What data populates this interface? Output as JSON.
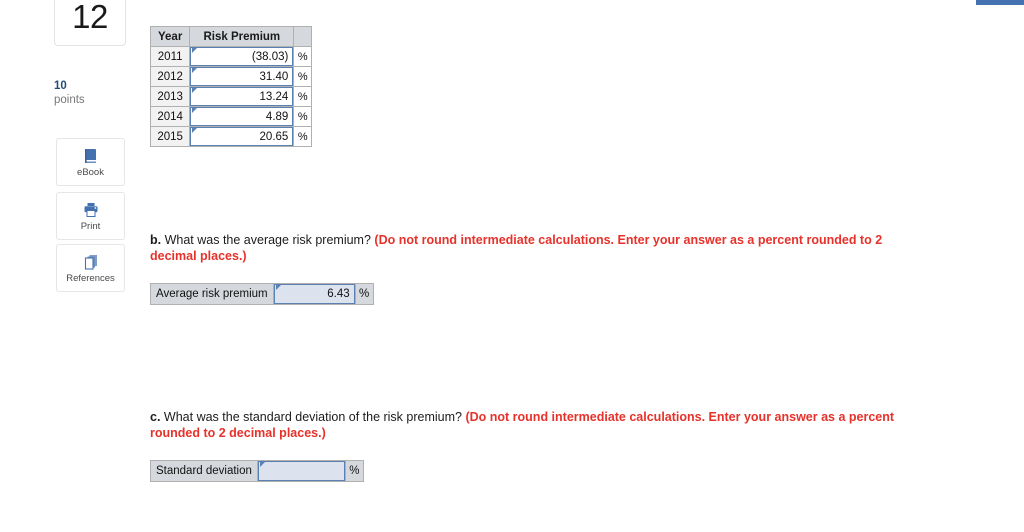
{
  "window": {
    "accent_color": "#4472b0",
    "top_bar_name": "cut-off-toolbar-strip"
  },
  "sidebar": {
    "question_number": "12",
    "points_value": "10",
    "points_label": "points",
    "tools": [
      {
        "label": "eBook",
        "icon": "ebook-icon"
      },
      {
        "label": "Print",
        "icon": "printer-icon"
      },
      {
        "label": "References",
        "icon": "references-icon"
      }
    ]
  },
  "risk_premium_table": {
    "headers": [
      "Year",
      "Risk Premium",
      ""
    ],
    "rows": [
      {
        "year": "2011",
        "value": "(38.03)",
        "unit": "%"
      },
      {
        "year": "2012",
        "value": "31.40",
        "unit": "%"
      },
      {
        "year": "2013",
        "value": "13.24",
        "unit": "%"
      },
      {
        "year": "2014",
        "value": "4.89",
        "unit": "%"
      },
      {
        "year": "2015",
        "value": "20.65",
        "unit": "%"
      }
    ]
  },
  "question_b": {
    "label": "b.",
    "prompt": "What was the average risk premium?",
    "instruction": "(Do not round intermediate calculations. Enter your answer as a percent rounded to 2 decimal places.)",
    "answer_label": "Average risk premium",
    "answer_value": "6.43",
    "answer_unit": "%"
  },
  "question_c": {
    "label": "c.",
    "prompt": "What was the standard deviation of the risk premium?",
    "instruction": "(Do not round intermediate calculations. Enter your answer as a percent rounded to 2 decimal places.)",
    "answer_label": "Standard deviation",
    "answer_value": "",
    "answer_unit": "%"
  }
}
